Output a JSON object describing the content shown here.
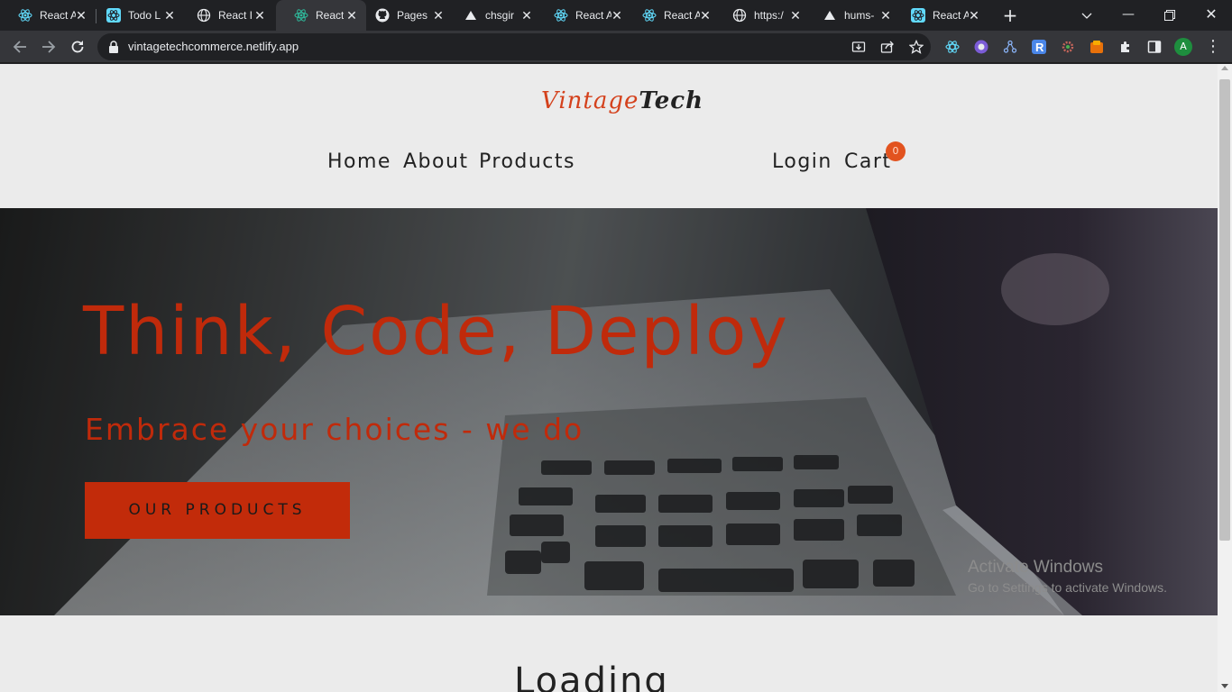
{
  "browser": {
    "tabs": [
      {
        "label": "React A",
        "icon": "react-icon"
      },
      {
        "label": "Todo L",
        "icon": "react-icon"
      },
      {
        "label": "React I",
        "icon": "globe-icon"
      },
      {
        "label": "React",
        "icon": "react-icon",
        "active": true
      },
      {
        "label": "Pages",
        "icon": "github-icon"
      },
      {
        "label": "chsgir",
        "icon": "vercel-icon"
      },
      {
        "label": "React A",
        "icon": "react-icon"
      },
      {
        "label": "React A",
        "icon": "react-icon"
      },
      {
        "label": "https:/",
        "icon": "globe-icon"
      },
      {
        "label": "hums-",
        "icon": "vercel-icon"
      },
      {
        "label": "React A",
        "icon": "react-icon"
      }
    ],
    "url": "vintagetechcommerce.netlify.app",
    "profile_initial": "A"
  },
  "site": {
    "logo_part1": "Vintage",
    "logo_part2": "Tech",
    "nav": {
      "home": "Home",
      "about": "About",
      "products": "Products",
      "login": "Login",
      "cart": "Cart",
      "cart_count": "0"
    },
    "hero": {
      "title": "Think, Code, Deploy",
      "subtitle": "Embrace your choices - we do",
      "button": "OUR PRODUCTS"
    },
    "loading": "Loading"
  },
  "watermark": {
    "line1": "Activate Windows",
    "line2": "Go to Settings to activate Windows."
  },
  "colors": {
    "accent": "#c02a0b",
    "logo_accent": "#d4411c",
    "badge": "#e2531f"
  }
}
